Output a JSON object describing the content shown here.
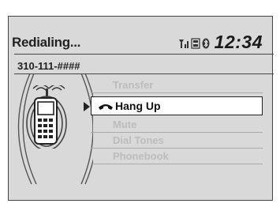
{
  "status": {
    "title": "Redialing...",
    "clock": "12:34",
    "number": "310-111-####"
  },
  "menu": {
    "items": [
      {
        "label": "Transfer",
        "selected": false
      },
      {
        "label": "Hang Up",
        "selected": true
      },
      {
        "label": "Mute",
        "selected": false
      },
      {
        "label": "Dial Tones",
        "selected": false
      },
      {
        "label": "Phonebook",
        "selected": false
      }
    ]
  },
  "icons": {
    "signal": "signal-icon",
    "roaming": "roam-icon",
    "bluetooth": "bluetooth-icon",
    "handset": "handset-icon",
    "phone": "mobile-phone-icon"
  }
}
